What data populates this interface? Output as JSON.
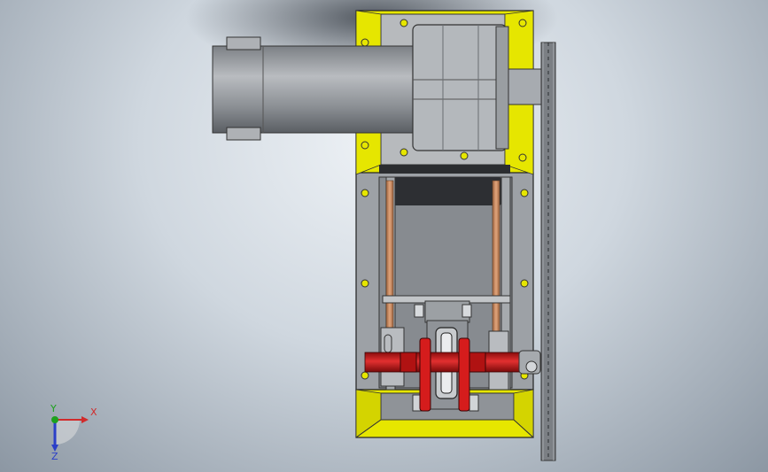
{
  "viewport": {
    "background": [
      "#eef2f6",
      "#8c97a3"
    ]
  },
  "model": {
    "description_colors": {
      "frame": "#e6e600",
      "steel": "#8e9296",
      "red_shaft": "#d01818",
      "rods": "#c6875f",
      "dark": "#2d2f33"
    }
  },
  "triad": {
    "x_label": "X",
    "y_label": "Y",
    "z_label": "Z",
    "x_color": "#d12b2b",
    "y_color": "#1da11d",
    "z_color": "#2b3fc8"
  }
}
